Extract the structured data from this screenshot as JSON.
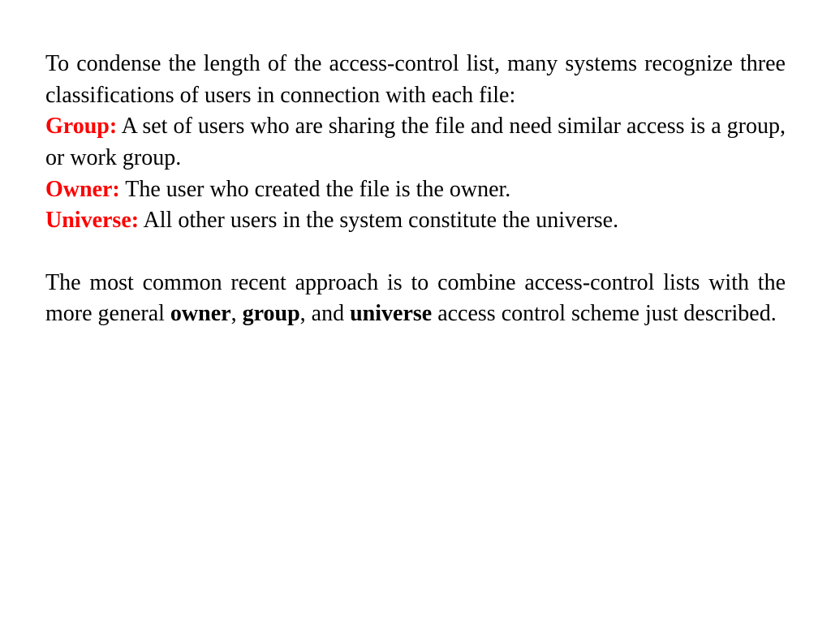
{
  "slide": {
    "intro": "To condense the length of the access-control list, many systems recognize three classifications of users in connection with each file:",
    "defs": [
      {
        "label": "Group:",
        "text": "  A set of users who are sharing the file and need similar access is a group, or work group."
      },
      {
        "label": "Owner:",
        "text": "  The user who created the file is the owner."
      },
      {
        "label": "Universe:",
        "text": "  All other users in the system constitute the universe."
      }
    ],
    "p2a": "The most common recent approach is to combine access-control lists with the more general ",
    "p2b": "owner",
    "p2c": ", ",
    "p2d": "group",
    "p2e": ", and ",
    "p2f": "universe",
    "p2g": " access control scheme just described."
  }
}
